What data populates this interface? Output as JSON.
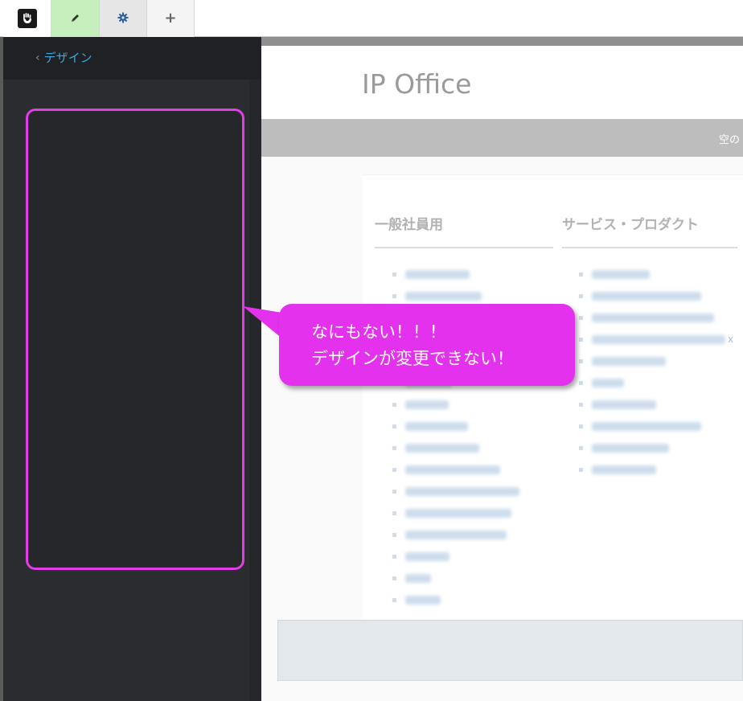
{
  "toolbar": {
    "logo_icon": "concrete5-logo-icon",
    "edit_icon": "pencil-icon",
    "settings_icon": "gear-icon",
    "add_icon": "plus-icon",
    "add_label": "+"
  },
  "panel": {
    "back_chevron": "‹",
    "back_label": "デザイン"
  },
  "preview": {
    "site_title": "IP Office",
    "gray_bar_text": "空の",
    "columns": [
      {
        "heading": "一般社員用",
        "item_count": 16
      },
      {
        "heading": "サービス・プロダクト",
        "item_count": 10
      }
    ],
    "stray_mark": "x"
  },
  "callout": {
    "line1": "なにもない！！！",
    "line2": "デザインが変更できない！"
  },
  "colors": {
    "accent_magenta": "#e331ee",
    "edit_active_bg": "#c6efbd",
    "panel_bg": "#2b2c30",
    "link_blue": "#3aa8de"
  }
}
